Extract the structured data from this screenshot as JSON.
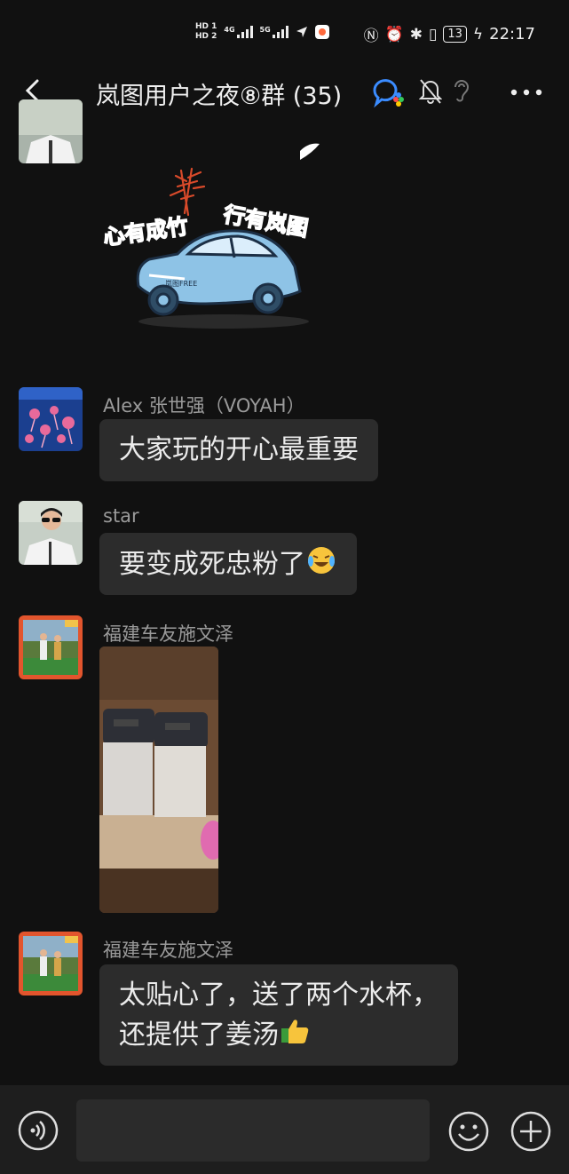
{
  "status_bar": {
    "hd1": "HD 1",
    "hd2": "HD 2",
    "net1": "4G",
    "net2": "5G",
    "battery": "13",
    "time": "22:17"
  },
  "header": {
    "title": "岚图用户之夜⑧群 (35)"
  },
  "sticker": {
    "text_left": "心有成竹",
    "text_right": "行有岚图",
    "car_badge": "岚图FREE"
  },
  "messages": [
    {
      "sender": "Alex 张世强（VOYAH）",
      "text": "大家玩的开心最重要"
    },
    {
      "sender": "star",
      "text": "要变成死忠粉了"
    },
    {
      "sender": "福建车友施文泽",
      "type": "image"
    },
    {
      "sender": "福建车友施文泽",
      "line1": "太贴心了，送了两个水杯，",
      "line2": "还提供了姜汤"
    }
  ],
  "input": {
    "placeholder": ""
  },
  "colors": {
    "bg": "#111111",
    "bubble": "#2c2c2c",
    "name": "#9a9a9a",
    "accent_red": "#e84c2c",
    "car_blue": "#8ec3e6"
  }
}
